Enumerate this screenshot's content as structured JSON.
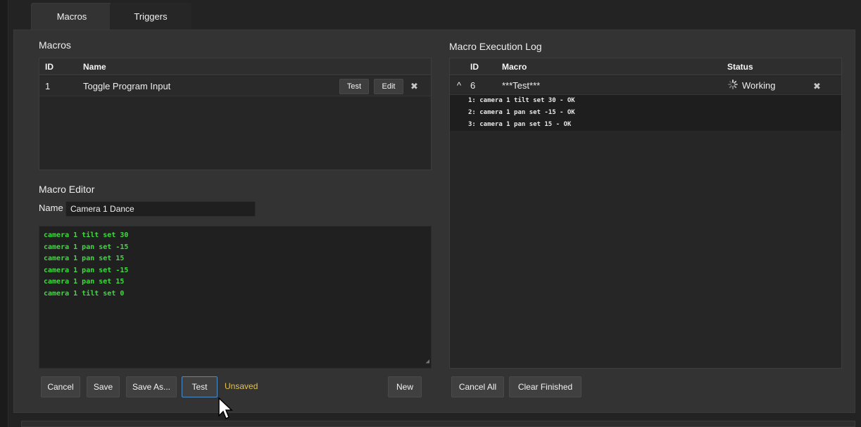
{
  "tabs": [
    {
      "label": "Macros",
      "active": true
    },
    {
      "label": "Triggers",
      "active": false
    }
  ],
  "macros": {
    "title": "Macros",
    "columns": {
      "id": "ID",
      "name": "Name"
    },
    "rows": [
      {
        "id": "1",
        "name": "Toggle Program Input",
        "test_label": "Test",
        "edit_label": "Edit",
        "delete_icon": "close-icon"
      }
    ]
  },
  "editor": {
    "title": "Macro Editor",
    "name_label": "Name",
    "name_value": "Camera 1 Dance",
    "lines": [
      "camera 1 tilt set 30",
      "camera 1 pan set -15",
      "camera 1 pan set 15",
      "camera 1 pan set -15",
      "camera 1 pan set 15",
      "camera 1 tilt set 0"
    ],
    "text_color": "#3edb3e",
    "buttons": {
      "cancel": "Cancel",
      "save": "Save",
      "save_as": "Save As...",
      "test": "Test",
      "new": "New"
    },
    "status": "Unsaved",
    "status_color": "#e6c24a"
  },
  "log": {
    "title": "Macro Execution Log",
    "columns": {
      "id": "ID",
      "macro": "Macro",
      "status": "Status"
    },
    "rows": [
      {
        "expand_icon": "^",
        "id": "6",
        "macro": "***Test***",
        "status": "Working",
        "status_icon": "spinner-icon",
        "delete_icon": "close-icon",
        "steps": [
          "1: camera 1 tilt set 30 - OK",
          "2: camera 1 pan set -15 - OK",
          "3: camera 1 pan set 15 - OK"
        ]
      }
    ],
    "buttons": {
      "cancel_all": "Cancel All",
      "clear_finished": "Clear Finished"
    }
  },
  "accent_focus": "#4d8cc9"
}
